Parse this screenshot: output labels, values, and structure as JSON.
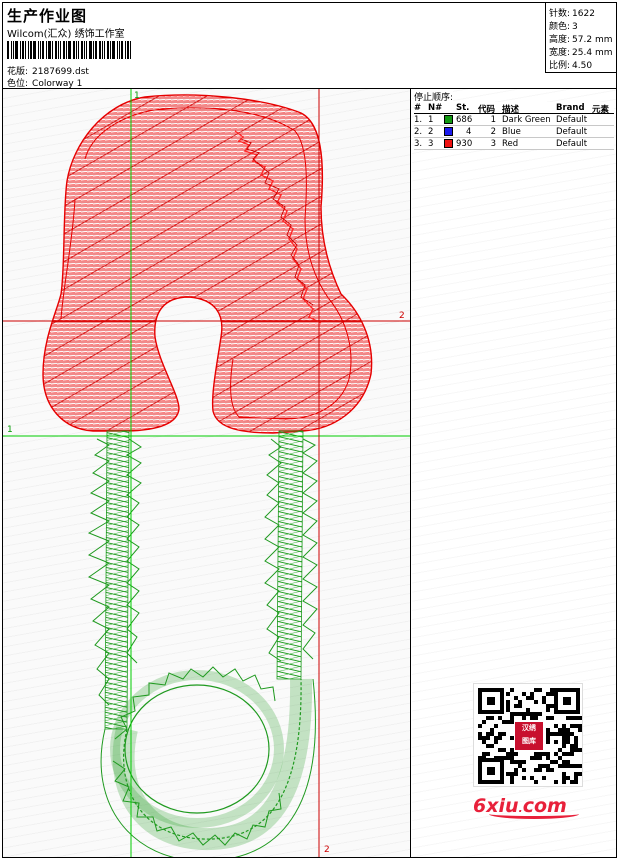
{
  "header": {
    "title": "生产作业图",
    "company": "Wilcom(汇众) 绣饰工作室",
    "design_label": "花版:",
    "design_file": "2187699.dst",
    "colorway_label": "色位:",
    "colorway": "Colorway 1"
  },
  "stats": [
    {
      "label": "针数:",
      "value": "1622"
    },
    {
      "label": "颜色:",
      "value": "3"
    },
    {
      "label": "高度:",
      "value": "57.2 mm"
    },
    {
      "label": "宽度:",
      "value": "25.4 mm"
    },
    {
      "label": "比例:",
      "value": "4.50"
    }
  ],
  "design": {
    "ref_v1": "1",
    "ref_h1": "1",
    "ref_h2": "2",
    "ref_v2": "2",
    "colors": {
      "guide_green": "#00cc00",
      "guide_red": "#cc0000",
      "thread_red": "#e60000",
      "thread_green": "#1f9a1f"
    }
  },
  "stop_sequence": {
    "title": "停止顺序:",
    "headers": {
      "num": "#",
      "n": "N#",
      "st": "St.",
      "code": "代码",
      "desc": "描述",
      "brand": "Brand",
      "elem": "元素"
    },
    "rows": [
      {
        "num": "1.",
        "n": "1",
        "color": "#119911",
        "st": "686",
        "code": "1",
        "desc": "Dark Green",
        "brand": "Default"
      },
      {
        "num": "2.",
        "n": "2",
        "color": "#1a1aee",
        "st": "4",
        "code": "2",
        "desc": "Blue",
        "brand": "Default"
      },
      {
        "num": "3.",
        "n": "3",
        "color": "#ee1111",
        "st": "930",
        "code": "3",
        "desc": "Red",
        "brand": "Default"
      }
    ]
  },
  "watermark": {
    "qr_text_1": "汉绣",
    "qr_text_2": "图库",
    "site_a": "6xiu",
    "site_dot": ".",
    "site_b": "com"
  }
}
